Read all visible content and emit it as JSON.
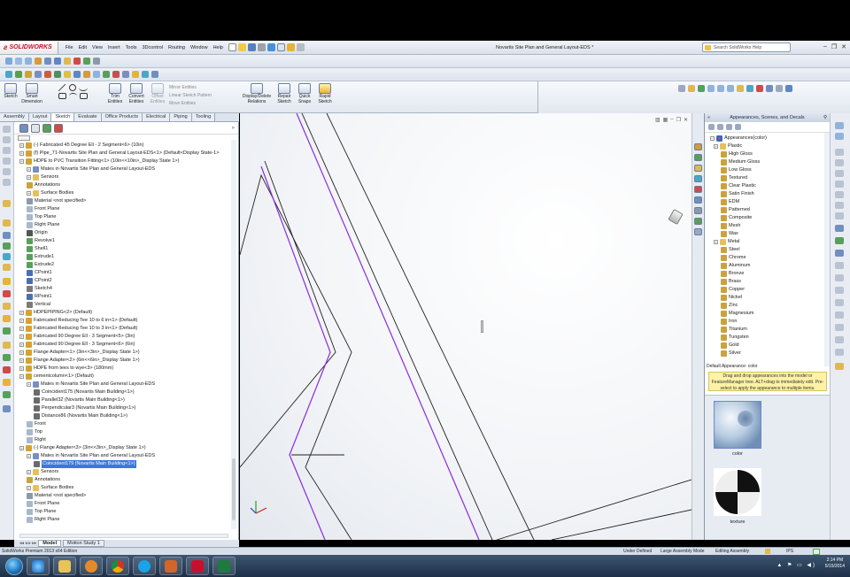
{
  "app": {
    "logo_text": "SOLIDWORKS",
    "document_title": "Novartis Site Plan and General Layout-EDS *",
    "search_placeholder": "Search SolidWorks Help",
    "menus": [
      "File",
      "Edit",
      "View",
      "Insert",
      "Tools",
      "3Dcontrol",
      "Routing",
      "Window",
      "Help"
    ]
  },
  "ribbon": {
    "buttons": [
      {
        "label": "Sketch"
      },
      {
        "label": "Smart Dimension"
      },
      {
        "label": "Trim Entities"
      },
      {
        "label": "Convert Entities"
      },
      {
        "label": "Offset Entities"
      },
      {
        "label": "Display/Delete Relations"
      },
      {
        "label": "Repair Sketch"
      },
      {
        "label": "Quick Snaps"
      },
      {
        "label": "Rapid Sketch"
      }
    ],
    "small": [
      "Mirror Entities",
      "Linear Sketch Pattern",
      "Move Entities"
    ]
  },
  "tabs": [
    "Assembly",
    "Layout",
    "Sketch",
    "Evaluate",
    "Office Products",
    "Electrical",
    "Piping",
    "Tooling"
  ],
  "active_tab": "Sketch",
  "tree": [
    {
      "text": "(-) Fabricated 45 Degree Ell - 2 Segment<6> (10in)",
      "indent": 0,
      "icon": "part"
    },
    {
      "text": "(f) Pipe_71-Novartis Site Plan and General Layout-EDS<1> (Default<Display State-1>",
      "indent": 0,
      "icon": "part"
    },
    {
      "text": "HDPE to PVC Transition Fitting<1> (10in<<10in>_Display State 1>)",
      "indent": 0,
      "icon": "part"
    },
    {
      "text": "Mates in Novartis Site Plan and General Layout-EDS",
      "indent": 1,
      "icon": "mates"
    },
    {
      "text": "Sensors",
      "indent": 1,
      "icon": "folder"
    },
    {
      "text": "Annotations",
      "indent": 1,
      "icon": "anno"
    },
    {
      "text": "Surface Bodies",
      "indent": 1,
      "icon": "folder"
    },
    {
      "text": "Material <not specified>",
      "indent": 1,
      "icon": "mat"
    },
    {
      "text": "Front Plane",
      "indent": 1,
      "icon": "plane"
    },
    {
      "text": "Top Plane",
      "indent": 1,
      "icon": "plane"
    },
    {
      "text": "Right Plane",
      "indent": 1,
      "icon": "plane"
    },
    {
      "text": "Origin",
      "indent": 1,
      "icon": "origin"
    },
    {
      "text": "Revolve1",
      "indent": 1,
      "icon": "feature"
    },
    {
      "text": "Shell1",
      "indent": 1,
      "icon": "feature"
    },
    {
      "text": "Extrude1",
      "indent": 1,
      "icon": "feature"
    },
    {
      "text": "Extrude2",
      "indent": 1,
      "icon": "feature"
    },
    {
      "text": "CPoint1",
      "indent": 1,
      "icon": "point"
    },
    {
      "text": "CPoint2",
      "indent": 1,
      "icon": "point"
    },
    {
      "text": "Sketch4",
      "indent": 1,
      "icon": "sketch"
    },
    {
      "text": "RPoint1",
      "indent": 1,
      "icon": "point"
    },
    {
      "text": "Vertical",
      "indent": 1,
      "icon": "sketch"
    },
    {
      "text": "HDPEPIPING<2> (Default)",
      "indent": 0,
      "icon": "part"
    },
    {
      "text": "Fabricated Reducing Tee 10 to 6 in<1> (Default)",
      "indent": 0,
      "icon": "part"
    },
    {
      "text": "Fabricated Reducing Tee 10 to 3 in<1> (Default)",
      "indent": 0,
      "icon": "part"
    },
    {
      "text": "Fabricated 90 Degree Ell - 3 Segment<5> (3in)",
      "indent": 0,
      "icon": "part"
    },
    {
      "text": "Fabricated 90 Degree Ell - 3 Segment<6> (6in)",
      "indent": 0,
      "icon": "part"
    },
    {
      "text": "Flange Adapter<1> (3in<<3in>_Display State 1>)",
      "indent": 0,
      "icon": "part"
    },
    {
      "text": "Flange Adapter<2> (6in<<6in>_Display State 1>)",
      "indent": 0,
      "icon": "part"
    },
    {
      "text": "HDPE from tees to wye<3> (180mm)",
      "indent": 0,
      "icon": "part"
    },
    {
      "text": "cementcolumn<1> (Default)",
      "indent": 0,
      "icon": "part"
    },
    {
      "text": "Mates in Novartis Site Plan and General Layout-EDS",
      "indent": 1,
      "icon": "mates"
    },
    {
      "text": "Coincident175 (Novartis Main Building<1>)",
      "indent": 2,
      "icon": "mate"
    },
    {
      "text": "Parallel32 (Novartis Main Building<1>)",
      "indent": 2,
      "icon": "mate"
    },
    {
      "text": "Perpendicular3 (Novartis Main Building<1>)",
      "indent": 2,
      "icon": "mate"
    },
    {
      "text": "Distance86 (Novartis Main Building<1>)",
      "indent": 2,
      "icon": "mate"
    },
    {
      "text": "Front",
      "indent": 1,
      "icon": "plane"
    },
    {
      "text": "Top",
      "indent": 1,
      "icon": "plane"
    },
    {
      "text": "Right",
      "indent": 1,
      "icon": "plane"
    },
    {
      "text": "(-) Flange Adapter<3> (3in<<3in>_Display State 1>)",
      "indent": 0,
      "icon": "part"
    },
    {
      "text": "Mates in Novartis Site Plan and General Layout-EDS",
      "indent": 1,
      "icon": "mates"
    },
    {
      "text": "Coincident179 (Novartis Main Building<1>)",
      "indent": 2,
      "icon": "mate",
      "selected": true
    },
    {
      "text": "Sensors",
      "indent": 1,
      "icon": "folder"
    },
    {
      "text": "Annotations",
      "indent": 1,
      "icon": "anno"
    },
    {
      "text": "Surface Bodies",
      "indent": 1,
      "icon": "folder"
    },
    {
      "text": "Material <not specified>",
      "indent": 1,
      "icon": "mat"
    },
    {
      "text": "Front Plane",
      "indent": 1,
      "icon": "plane"
    },
    {
      "text": "Top Plane",
      "indent": 1,
      "icon": "plane"
    },
    {
      "text": "Right Plane",
      "indent": 1,
      "icon": "plane"
    }
  ],
  "bottom_tabs": [
    "Model",
    "Motion Study 1"
  ],
  "taskpane": {
    "title": "Appearances, Scenes, and Decals",
    "root": "Appearances(color)",
    "items": [
      {
        "text": "Plastic",
        "indent": 1,
        "icon": "folder"
      },
      {
        "text": "High Gloss",
        "indent": 2,
        "icon": "swatch"
      },
      {
        "text": "Medium Gloss",
        "indent": 2,
        "icon": "swatch"
      },
      {
        "text": "Low Gloss",
        "indent": 2,
        "icon": "swatch"
      },
      {
        "text": "Textured",
        "indent": 2,
        "icon": "swatch"
      },
      {
        "text": "Clear Plastic",
        "indent": 2,
        "icon": "swatch"
      },
      {
        "text": "Satin Finish",
        "indent": 2,
        "icon": "swatch"
      },
      {
        "text": "EDM",
        "indent": 2,
        "icon": "swatch"
      },
      {
        "text": "Patterned",
        "indent": 2,
        "icon": "swatch"
      },
      {
        "text": "Composite",
        "indent": 2,
        "icon": "swatch"
      },
      {
        "text": "Mesh",
        "indent": 2,
        "icon": "swatch"
      },
      {
        "text": "Wax",
        "indent": 2,
        "icon": "swatch"
      },
      {
        "text": "Metal",
        "indent": 1,
        "icon": "folder"
      },
      {
        "text": "Steel",
        "indent": 2,
        "icon": "swatch"
      },
      {
        "text": "Chrome",
        "indent": 2,
        "icon": "swatch"
      },
      {
        "text": "Aluminum",
        "indent": 2,
        "icon": "swatch"
      },
      {
        "text": "Bronze",
        "indent": 2,
        "icon": "swatch"
      },
      {
        "text": "Brass",
        "indent": 2,
        "icon": "swatch"
      },
      {
        "text": "Copper",
        "indent": 2,
        "icon": "swatch"
      },
      {
        "text": "Nickel",
        "indent": 2,
        "icon": "swatch"
      },
      {
        "text": "Zinc",
        "indent": 2,
        "icon": "swatch"
      },
      {
        "text": "Magnesium",
        "indent": 2,
        "icon": "swatch"
      },
      {
        "text": "Iron",
        "indent": 2,
        "icon": "swatch"
      },
      {
        "text": "Titanium",
        "indent": 2,
        "icon": "swatch"
      },
      {
        "text": "Tungsten",
        "indent": 2,
        "icon": "swatch"
      },
      {
        "text": "Gold",
        "indent": 2,
        "icon": "swatch"
      },
      {
        "text": "Silver",
        "indent": 2,
        "icon": "swatch"
      }
    ],
    "default_appearance": "Default Appearance: color",
    "hint": "Drag and drop appearances into the model or FeatureManager tree. ALT+drag to immediately edit. Pre-select to apply the appearance to multiple items.",
    "swatches": [
      {
        "label": "color"
      },
      {
        "label": "texture"
      }
    ]
  },
  "status": {
    "left": "SolidWorks Premium 2013 x64 Edition",
    "mode1": "Under Defined",
    "mode2": "Large Assembly Mode",
    "mode3": "Editing Assembly",
    "units": "IPS"
  },
  "clock": {
    "time": "2:14 PM",
    "date": "5/15/2014"
  },
  "colors": {
    "sketch_line": "#8a2be2",
    "selection": "#3c78d8",
    "accent": "#c8102e"
  }
}
